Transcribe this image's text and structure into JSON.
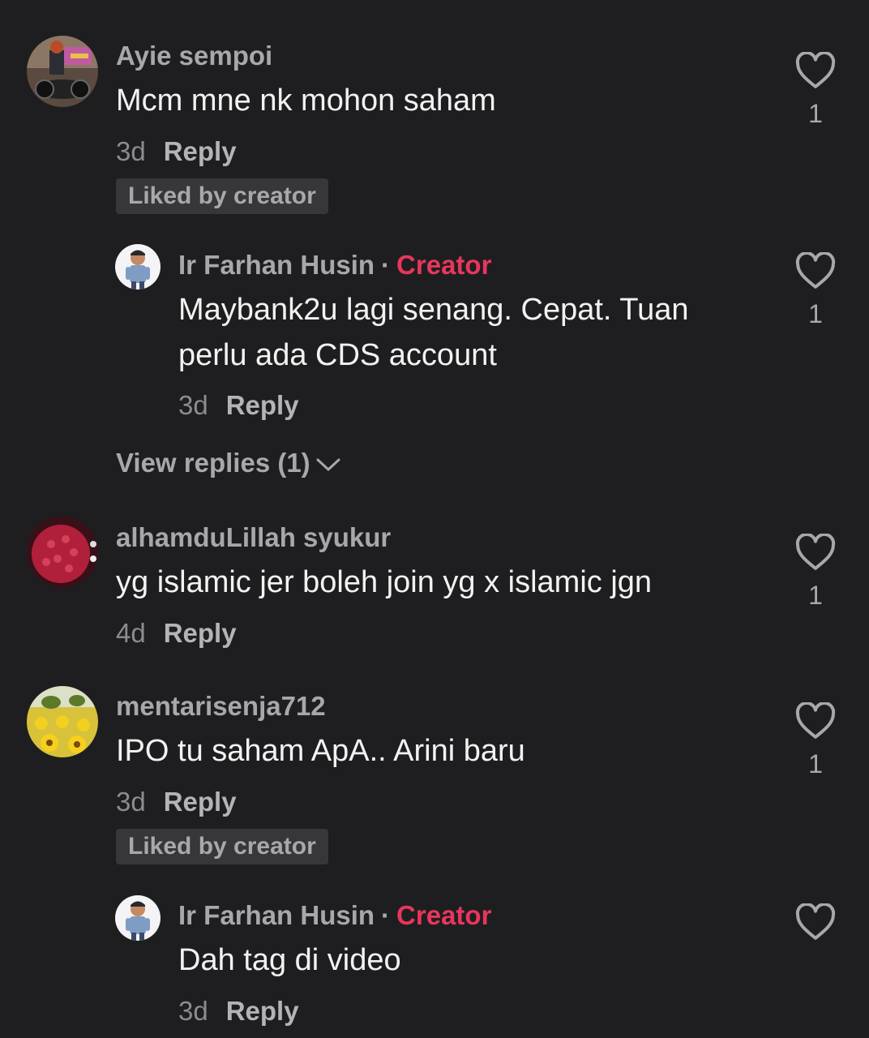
{
  "comments": [
    {
      "username": "Ayie sempoi",
      "text": "Mcm mne nk mohon saham",
      "time": "3d",
      "reply_label": "Reply",
      "badge": "Liked by creator",
      "likes": "1",
      "avatar": "motorcycle-photo"
    },
    {
      "username": "Ir Farhan Husin",
      "separator": "·",
      "role": "Creator",
      "text": "Maybank2u lagi senang. Cepat. Tuan perlu ada CDS account",
      "time": "3d",
      "reply_label": "Reply",
      "likes": "1",
      "avatar": "cartoon-person"
    },
    {
      "view_replies": "View replies (1)"
    },
    {
      "username": "alhamduLillah syukur",
      "text": "yg islamic jer boleh join yg x islamic jgn",
      "time": "4d",
      "reply_label": "Reply",
      "likes": "1",
      "avatar": "red-fruit"
    },
    {
      "username": "mentarisenja712",
      "text": "IPO tu saham ApA.. Arini baru",
      "time": "3d",
      "reply_label": "Reply",
      "badge": "Liked by creator",
      "likes": "1",
      "avatar": "sunflower-field"
    },
    {
      "username": "Ir Farhan Husin",
      "separator": "·",
      "role": "Creator",
      "text": "Dah tag di video",
      "time": "3d",
      "reply_label": "Reply",
      "likes": "",
      "avatar": "cartoon-person"
    }
  ],
  "colors": {
    "background": "#1e1e20",
    "creator": "#e8365d",
    "muted": "#a8a8aa",
    "badge_bg": "#37373a"
  }
}
